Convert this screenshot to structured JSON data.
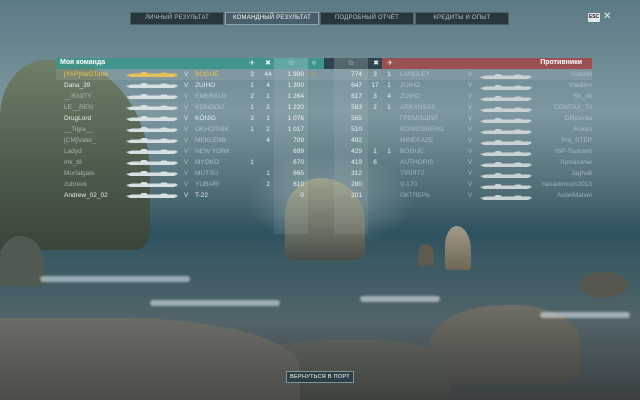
{
  "tabs": [
    {
      "label": "ЛИЧНЫЙ РЕЗУЛЬТАТ",
      "active": false
    },
    {
      "label": "КОМАНДНЫЙ РЕЗУЛЬТАТ",
      "active": true
    },
    {
      "label": "ПОДРОБНЫЙ ОТЧЁТ",
      "active": false
    },
    {
      "label": "КРЕДИТЫ И ОПЫТ",
      "active": false
    }
  ],
  "esc_label": "ESC",
  "close_glyph": "✕",
  "my_team": {
    "title": "Моя команда",
    "header_icons": [
      "plane-icon",
      "crosshair-icon",
      "star-icon",
      "laurel-icon"
    ],
    "players": [
      {
        "name": "[YAP]NeOTonik",
        "tier": "V",
        "ship": "BOGUE",
        "c1": "3",
        "c2": "44",
        "xp": "1 900",
        "medal": "☺",
        "me": true,
        "dimmed": false
      },
      {
        "name": "Dana_39",
        "tier": "V",
        "ship": "ZUIHO",
        "c1": "1",
        "c2": "4",
        "xp": "1 300",
        "medal": "",
        "me": false,
        "dimmed": false
      },
      {
        "name": "__R33TY",
        "tier": "V",
        "ship": "EMERALD",
        "c1": "2",
        "c2": "1",
        "xp": "1 264",
        "medal": "",
        "me": false,
        "dimmed": true
      },
      {
        "name": "LE__REN",
        "tier": "V",
        "ship": "KONGOU",
        "c1": "1",
        "c2": "2",
        "xp": "1 220",
        "medal": "",
        "me": false,
        "dimmed": true
      },
      {
        "name": "DrugLord",
        "tier": "V",
        "ship": "KÖNIG",
        "c1": "3",
        "c2": "1",
        "xp": "1 076",
        "medal": "",
        "me": false,
        "dimmed": false
      },
      {
        "name": "__Tigra__",
        "tier": "V",
        "ship": "OKHOTNIK",
        "c1": "1",
        "c2": "2",
        "xp": "1 017",
        "medal": "",
        "me": false,
        "dimmed": true
      },
      {
        "name": "[CM]Valer_",
        "tier": "V",
        "ship": "MEKLENB.",
        "c1": "",
        "c2": "4",
        "xp": "709",
        "medal": "",
        "me": false,
        "dimmed": true
      },
      {
        "name": "Ladyd",
        "tier": "V",
        "ship": "NEW YORK",
        "c1": "",
        "c2": "",
        "xp": "699",
        "medal": "",
        "me": false,
        "dimmed": true
      },
      {
        "name": "mk_t8",
        "tier": "V",
        "ship": "MYOKO",
        "c1": "1",
        "c2": "",
        "xp": "670",
        "medal": "",
        "me": false,
        "dimmed": true
      },
      {
        "name": "Mortalgate",
        "tier": "V",
        "ship": "MUTSU",
        "c1": "",
        "c2": "1",
        "xp": "665",
        "medal": "",
        "me": false,
        "dimmed": true
      },
      {
        "name": "zubreek",
        "tier": "V",
        "ship": "YUBARI",
        "c1": "",
        "c2": "2",
        "xp": "610",
        "medal": "",
        "me": false,
        "dimmed": true
      },
      {
        "name": "Andrew_02_02",
        "tier": "V",
        "ship": "T-22",
        "c1": "",
        "c2": "",
        "xp": "0",
        "medal": "",
        "me": false,
        "dimmed": false
      }
    ]
  },
  "enemy_team": {
    "title": "Противники",
    "header_icons": [
      "star-icon",
      "crosshair-icon",
      "plane-icon"
    ],
    "players": [
      {
        "xp": "774",
        "c2": "3",
        "c1": "1",
        "ship": "LANGLEY",
        "tier": "V",
        "name": "Gabriel"
      },
      {
        "xp": "647",
        "c2": "17",
        "c1": "1",
        "ship": "ZUIHO",
        "tier": "V",
        "name": "Vladilen"
      },
      {
        "xp": "617",
        "c2": "3",
        "c1": "4",
        "ship": "ZUIHO",
        "tier": "V",
        "name": "Sh_rik"
      },
      {
        "xp": "583",
        "c2": "2",
        "c1": "1",
        "ship": "ARKANSAS",
        "tier": "V",
        "name": "COMTAX_70"
      },
      {
        "xp": "565",
        "c2": "",
        "c1": "",
        "ship": "ГРЕМЯЩИЙ",
        "tier": "V",
        "name": "DRizeraa"
      },
      {
        "xp": "510",
        "c2": "",
        "c1": "",
        "ship": "KONIGSBERG",
        "tier": "V",
        "name": "Rokko"
      },
      {
        "xp": "492",
        "c2": "",
        "c1": "",
        "ship": "MINEKAZE",
        "tier": "V",
        "name": "Pro_STEP"
      },
      {
        "xp": "429",
        "c2": "1",
        "c1": "1",
        "ship": "BOGUE",
        "tier": "V",
        "name": "ISP-Tsunami"
      },
      {
        "xp": "419",
        "c2": "6",
        "c1": "",
        "ship": "AUTHORIS",
        "tier": "V",
        "name": "Apslavanie"
      },
      {
        "xp": "312",
        "c2": "",
        "c1": "",
        "ship": "TIRPITZ",
        "tier": "V",
        "name": "Jaghalt"
      },
      {
        "xp": "280",
        "c2": "",
        "c1": "",
        "ship": "V-170",
        "tier": "V",
        "name": "hasadonium2013"
      },
      {
        "xp": "201",
        "c2": "",
        "c1": "",
        "ship": "ОКТЯБРЬ",
        "tier": "V",
        "name": "AvdelMatvei"
      }
    ]
  },
  "back_button": "ВЕРНУТЬСЯ В ПОРТ",
  "colors": {
    "ally_header": "#3a968c",
    "enemy_header": "#aa3c3c",
    "highlight_name": "#f1c44a"
  }
}
